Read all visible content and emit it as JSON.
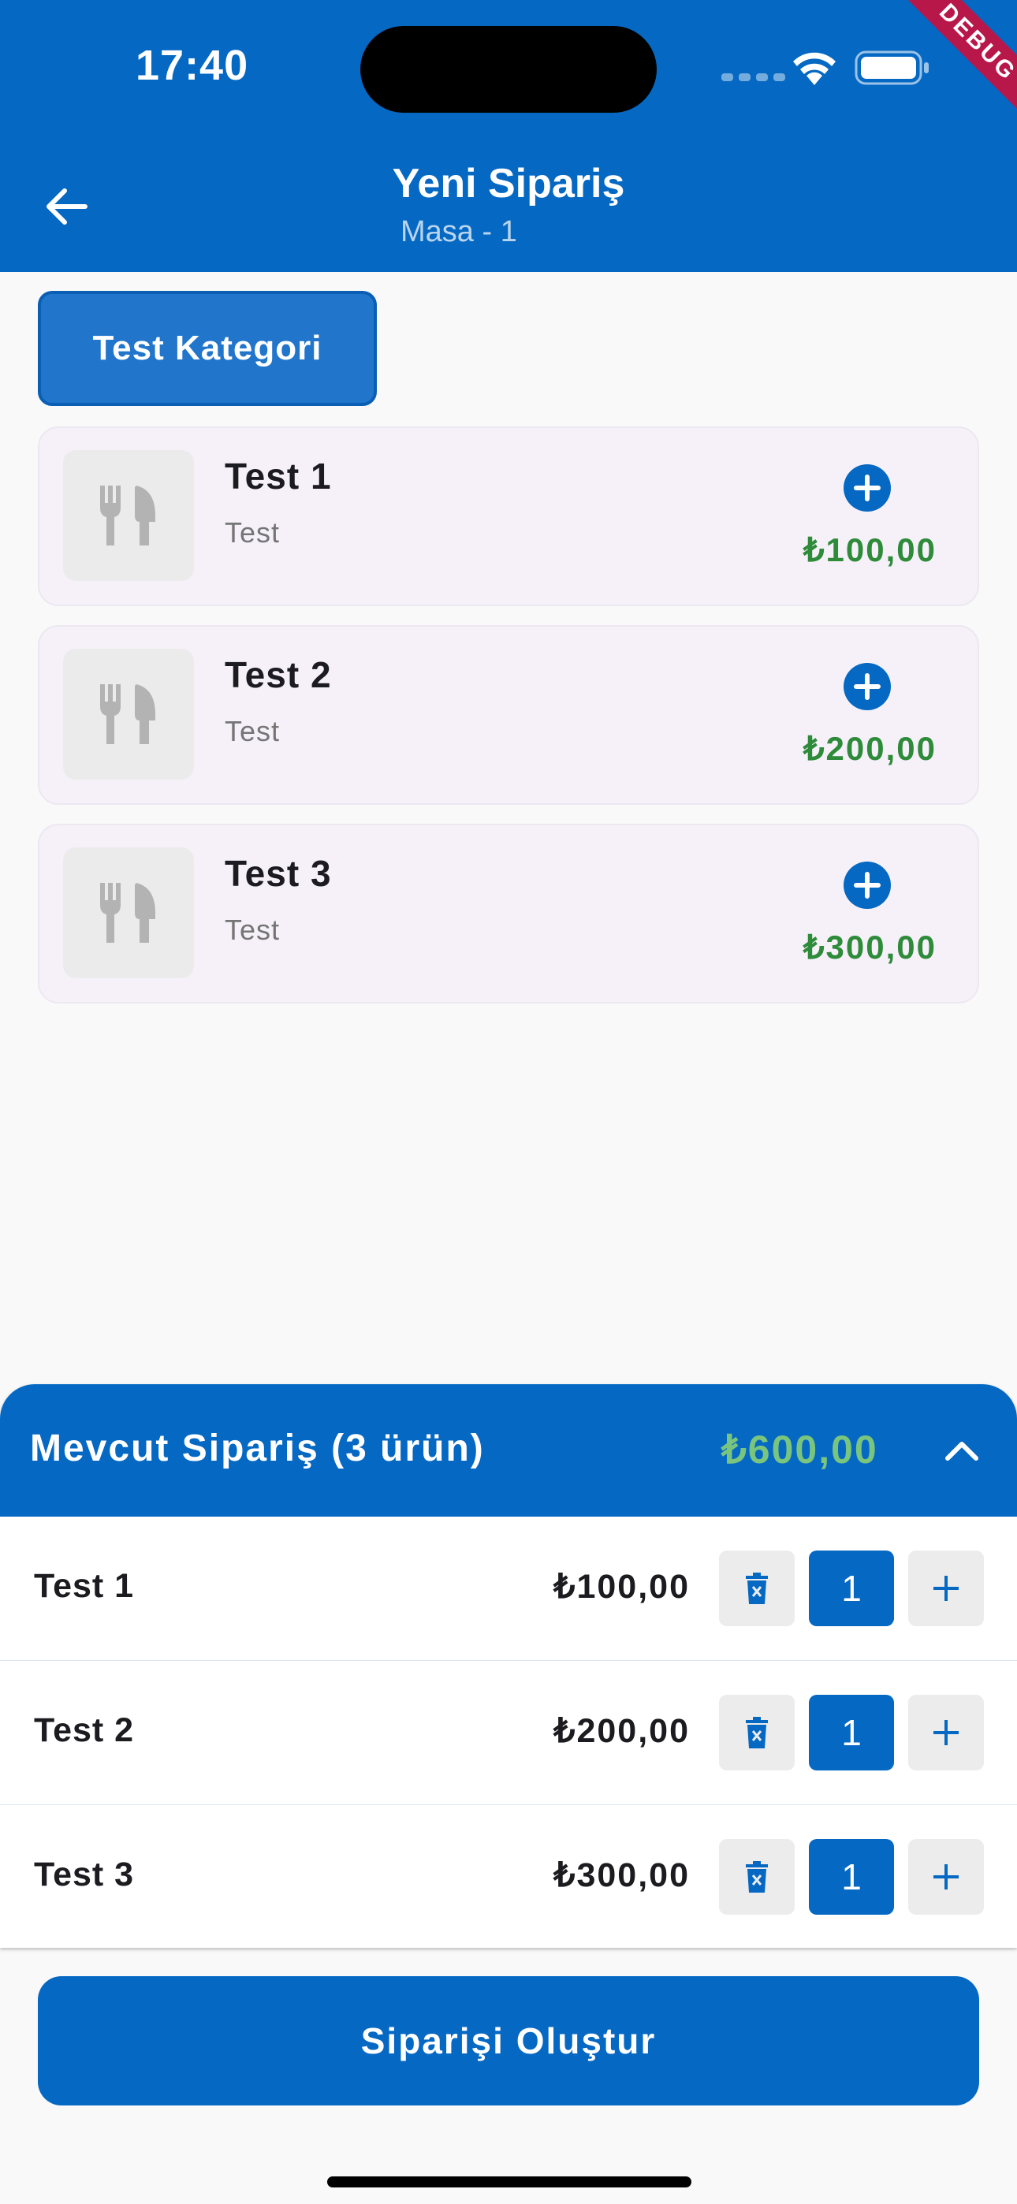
{
  "status_bar": {
    "time": "17:40",
    "debug_label": "DEBUG"
  },
  "header": {
    "title": "Yeni Sipariş",
    "subtitle": "Masa - 1",
    "back_icon": "arrow-left-icon"
  },
  "category": {
    "label": "Test Kategori"
  },
  "products": [
    {
      "name": "Test 1",
      "description": "Test",
      "price": "₺100,00"
    },
    {
      "name": "Test 2",
      "description": "Test",
      "price": "₺200,00"
    },
    {
      "name": "Test 3",
      "description": "Test",
      "price": "₺300,00"
    }
  ],
  "order": {
    "title": "Mevcut Sipariş (3 ürün)",
    "total": "₺600,00",
    "items": [
      {
        "name": "Test 1",
        "price": "₺100,00",
        "quantity": "1"
      },
      {
        "name": "Test 2",
        "price": "₺200,00",
        "quantity": "1"
      },
      {
        "name": "Test 3",
        "price": "₺300,00",
        "quantity": "1"
      }
    ]
  },
  "actions": {
    "create_order": "Siparişi Oluştur"
  },
  "colors": {
    "primary": "#0568c3",
    "price_green": "#2e8b3a",
    "total_green": "#79c57e",
    "card_bg": "#f6f1f9"
  }
}
